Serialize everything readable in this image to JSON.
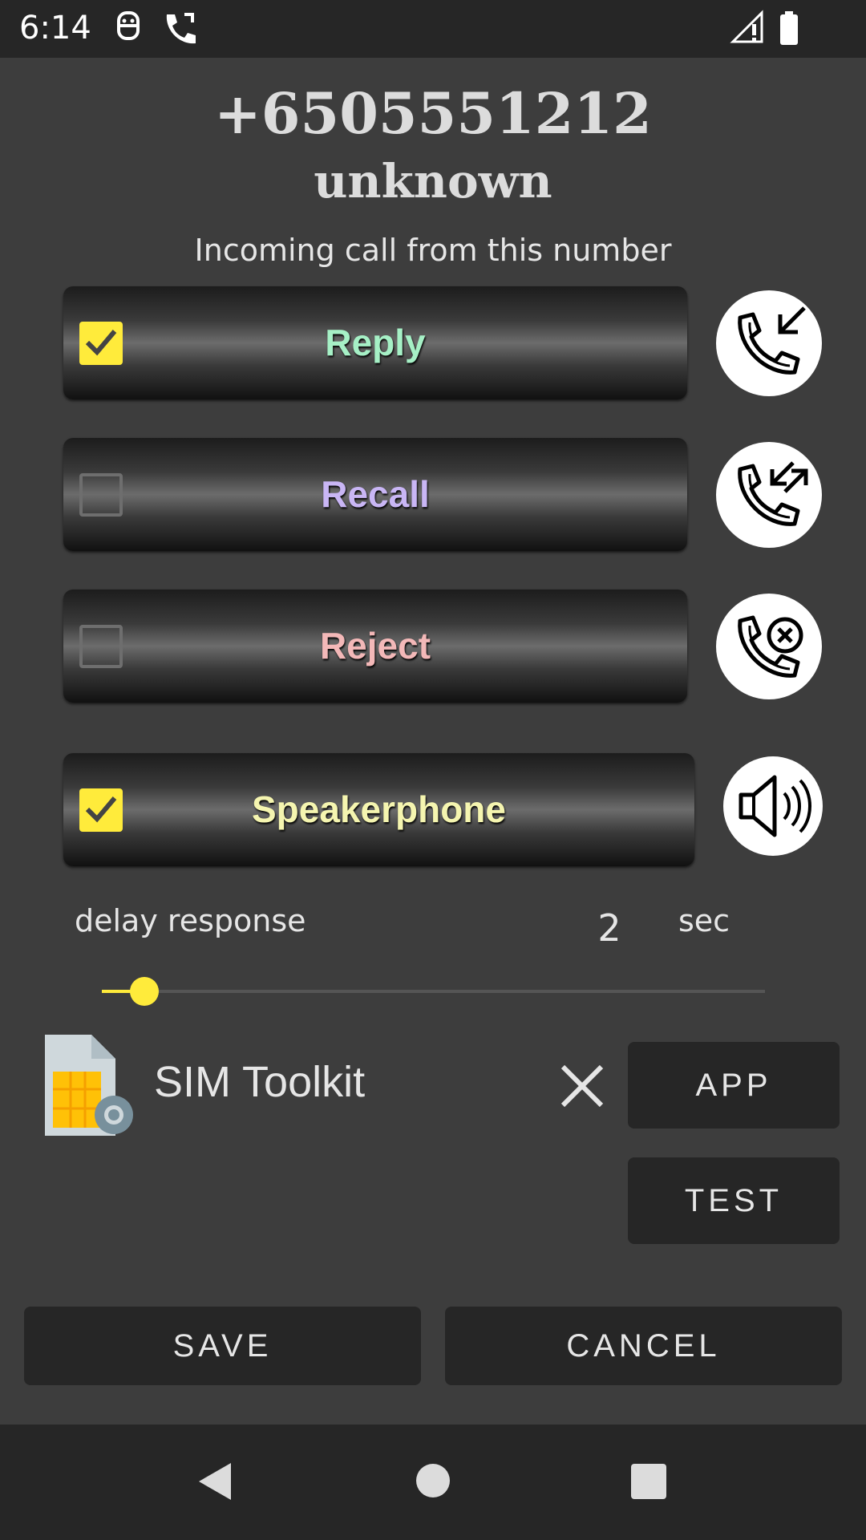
{
  "status_bar": {
    "time": "6:14"
  },
  "caller": {
    "number": "+6505551212",
    "name": "unknown",
    "subtitle": "Incoming call from this number"
  },
  "actions": [
    {
      "label": "Reply",
      "checked": true,
      "color": "#a6f0c6",
      "icon": "incoming-call-icon"
    },
    {
      "label": "Recall",
      "checked": false,
      "color": "#c9b6f5",
      "icon": "callback-icon"
    },
    {
      "label": "Reject",
      "checked": false,
      "color": "#f3b8b8",
      "icon": "reject-call-icon"
    },
    {
      "label": "Speakerphone",
      "checked": true,
      "color": "#f5f5b0",
      "icon": "speaker-icon"
    }
  ],
  "delay": {
    "label": "delay response",
    "value": "2",
    "unit": "sec",
    "slider_fraction": 0.06
  },
  "app": {
    "name": "SIM Toolkit",
    "icon": "sim-card-icon",
    "app_button": "APP",
    "test_button": "TEST"
  },
  "footer": {
    "save": "SAVE",
    "cancel": "CANCEL"
  },
  "colors": {
    "accent": "#ffeb3b",
    "background": "#3d3d3d",
    "bar": "#262626"
  }
}
